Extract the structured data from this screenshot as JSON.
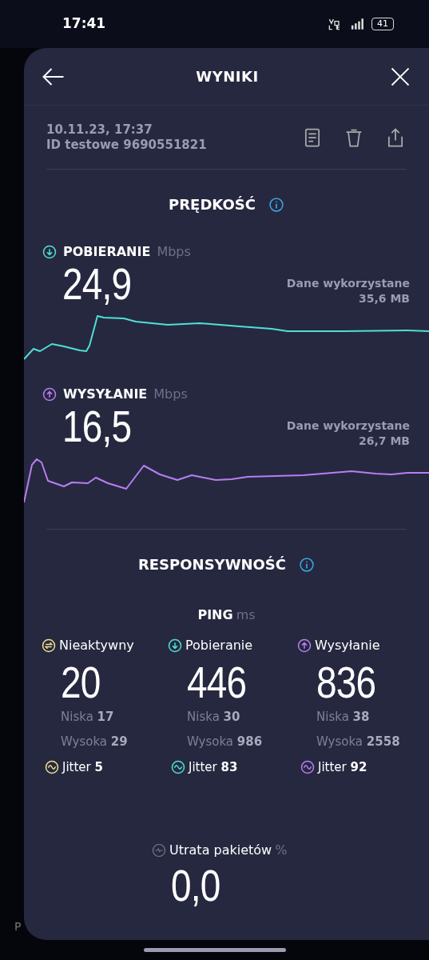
{
  "status_bar": {
    "time": "17:41",
    "battery": "41"
  },
  "header": {
    "title": "WYNIKI"
  },
  "test": {
    "date": "10.11.23, 17:37",
    "id": "ID testowe 9690551821"
  },
  "speed": {
    "title": "PRĘDKOŚĆ",
    "metrics": [
      {
        "kind": "download",
        "label": "POBIERANIE",
        "unit": "Mbps",
        "value": "24,9",
        "data_label": "Dane wykorzystane",
        "data_value": "35,6 MB",
        "color": "#4fe0d2"
      },
      {
        "kind": "upload",
        "label": "WYSYŁANIE",
        "unit": "Mbps",
        "value": "16,5",
        "data_label": "Dane wykorzystane",
        "data_value": "26,7 MB",
        "color": "#b87ef2"
      }
    ]
  },
  "responsiveness": {
    "title": "RESPONSYWNOŚĆ",
    "ping_label": "PING",
    "ping_unit": "ms",
    "columns": [
      {
        "kind": "idle",
        "label": "Nieaktywny",
        "value": "20",
        "low_label": "Niska",
        "low": "17",
        "high_label": "Wysoka",
        "high": "29",
        "jitter_label": "Jitter",
        "jitter": "5",
        "color": "#efe08c"
      },
      {
        "kind": "download",
        "label": "Pobieranie",
        "value": "446",
        "low_label": "Niska",
        "low": "30",
        "high_label": "Wysoka",
        "high": "986",
        "jitter_label": "Jitter",
        "jitter": "83",
        "color": "#4fe0d2"
      },
      {
        "kind": "upload",
        "label": "Wysyłanie",
        "value": "836",
        "low_label": "Niska",
        "low": "38",
        "high_label": "Wysoka",
        "high": "2558",
        "jitter_label": "Jitter",
        "jitter": "92",
        "color": "#b87ef2"
      }
    ]
  },
  "packet_loss": {
    "label": "Utrata pakietów",
    "unit": "%",
    "value": "0,0"
  },
  "background_text": "P"
}
